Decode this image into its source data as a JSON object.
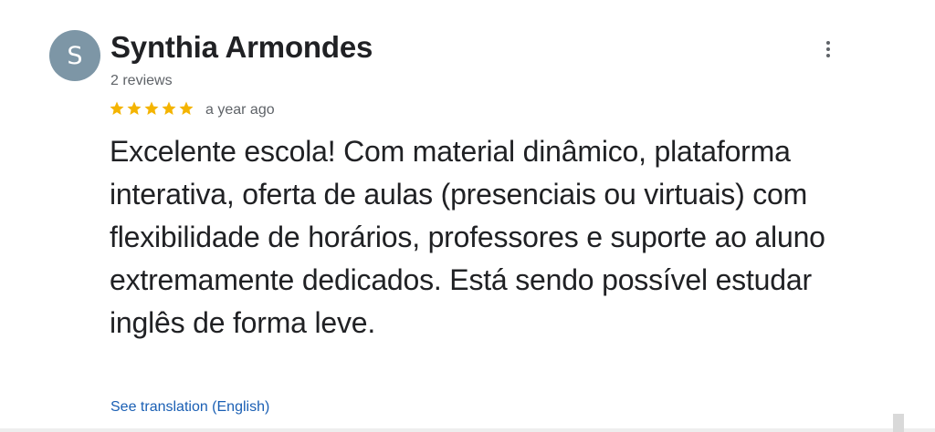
{
  "reviewer": {
    "avatar_initial": "S",
    "name": "Synthia Armondes",
    "review_count": "2 reviews"
  },
  "rating": {
    "stars": 5,
    "max_stars": 5,
    "star_color": "#f4b400",
    "time_ago": "a year ago"
  },
  "review": {
    "text": "Excelente escola! Com material dinâmico, plataforma interativa, oferta de aulas (presenciais ou virtuais) com flexibilidade de horários, professores e suporte ao aluno extremamente dedicados. Está sendo possível estudar inglês de forma leve."
  },
  "actions": {
    "translate_label": "See translation (English)",
    "menu_icon": "more-vert-icon"
  },
  "colors": {
    "avatar_bg": "#7d96a6",
    "link": "#1a5fb4"
  }
}
